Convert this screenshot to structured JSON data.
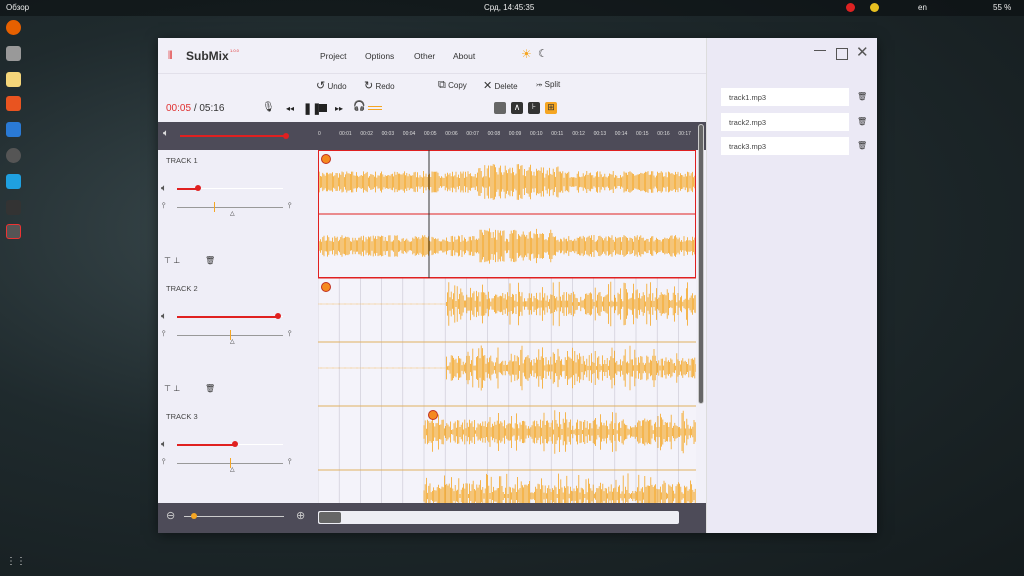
{
  "desktop": {
    "activities": "Обзор",
    "clock": "Срд, 14:45:35",
    "lang": "en",
    "battery": "55 %"
  },
  "app": {
    "name": "SubMix",
    "version": "1.0.0",
    "menu": [
      "Project",
      "Options",
      "Other",
      "About"
    ],
    "toolbar": {
      "undo": "Undo",
      "redo": "Redo",
      "copy": "Copy",
      "delete": "Delete",
      "split": "Split"
    },
    "time": {
      "current": "00:05",
      "total": "/ 05:16"
    },
    "ticks": [
      "0",
      "00:01",
      "00:02",
      "00:03",
      "00:04",
      "00:05",
      "00:06",
      "00:07",
      "00:08",
      "00:09",
      "00:10",
      "00:11",
      "00:12",
      "00:13",
      "00:14",
      "00:15",
      "00:16",
      "00:17"
    ],
    "master_volume": 0.95,
    "tracks": [
      {
        "name": "TRACK 1",
        "volume": 0.2,
        "pan": 0.35,
        "selected": true
      },
      {
        "name": "TRACK 2",
        "volume": 0.95,
        "pan": 0.5,
        "selected": false
      },
      {
        "name": "TRACK 3",
        "volume": 0.55,
        "pan": 0.5,
        "selected": false
      }
    ],
    "zoom_level": 0.1,
    "files": [
      "track1.mp3",
      "track2.mp3",
      "track3.mp3"
    ],
    "accent": "#f5a623",
    "red": "#e02020"
  }
}
